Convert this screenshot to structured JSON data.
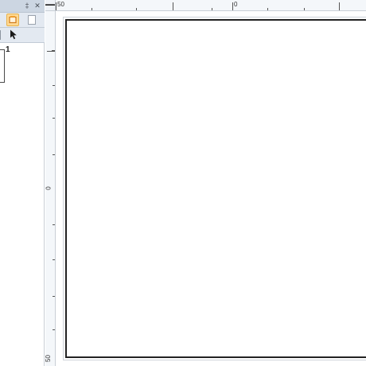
{
  "panel": {
    "pin_glyph": "‡",
    "close_glyph": "✕",
    "toolbar": {
      "pages_tool_icon": "pages-tool-icon",
      "page_tool_icon": "page-icon",
      "pointer_tool_icon": "arrow-pointer-icon"
    },
    "thumbnails": [
      {
        "number": "1"
      }
    ]
  },
  "rulers": {
    "unit": "▬▬",
    "horizontal": {
      "labels": [
        "50",
        "0"
      ]
    },
    "vertical": {
      "labels": [
        "0",
        "50"
      ]
    }
  },
  "colors": {
    "accent_button": "#ffd994",
    "panel_title": "#ccd6e2",
    "toolbar": "#e3e9f1"
  }
}
